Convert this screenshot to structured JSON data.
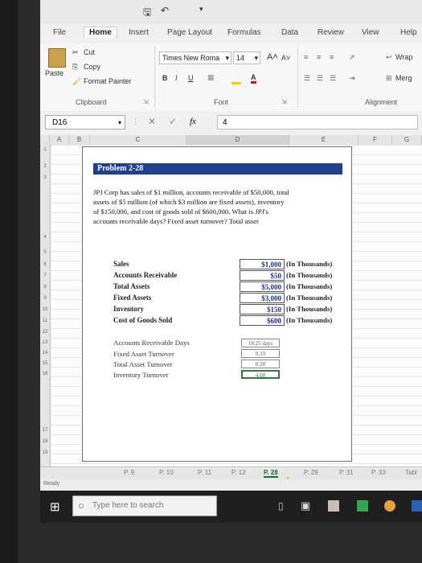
{
  "titlebar": {
    "save_icon": "save-icon",
    "undo_icon": "undo-icon"
  },
  "tabs": [
    "File",
    "Home",
    "Insert",
    "Page Layout",
    "Formulas",
    "Data",
    "Review",
    "View",
    "Help"
  ],
  "ribbon": {
    "cut": "Cut",
    "copy": "Copy",
    "paste": "Paste",
    "format_painter": "Format Painter",
    "clipboard_label": "Clipboard",
    "font_name": "Times New Roma",
    "font_size": "14",
    "bold": "B",
    "italic": "I",
    "underline": "U",
    "font_label": "Font",
    "wrap_text": "Wrap",
    "merge": "Merg",
    "alignment_label": "Alignment"
  },
  "formula_bar": {
    "name_box": "D16",
    "fx": "fx",
    "value": "4"
  },
  "columns": [
    "A",
    "B",
    "C",
    "D",
    "E",
    "F",
    "G"
  ],
  "rows": [
    "1",
    "2",
    "3",
    "4",
    "5",
    "6",
    "7",
    "8",
    "9",
    "10",
    "11",
    "12",
    "13",
    "14",
    "15",
    "16",
    "17",
    "18",
    "19"
  ],
  "problem": {
    "title": "Problem 2-28",
    "text": "JPJ Corp has sales of $1 million, accounts receivable of $50,000, total assets of $5 million (of which $3 million are fixed assets), inventory of $150,000, and cost of goods sold of $600,000. What is JPJ's accounts receivable days? Fixed asset turnover? Total asset",
    "inputs": [
      {
        "label": "Sales",
        "value": "$1,000",
        "unit": "(In Thousands)"
      },
      {
        "label": "Accounts Receivable",
        "value": "$50",
        "unit": "(In Thousands)"
      },
      {
        "label": "Total Assets",
        "value": "$5,000",
        "unit": "(In Thousands)"
      },
      {
        "label": "Fixed Assets",
        "value": "$3,000",
        "unit": "(In Thousands)"
      },
      {
        "label": "Inventory",
        "value": "$150",
        "unit": "(In Thousands)"
      },
      {
        "label": "Cost of Goods Sold",
        "value": "$600",
        "unit": "(In Thousands)"
      }
    ],
    "results": [
      {
        "label": "Accounts Receivable Days",
        "value": "18.25 days"
      },
      {
        "label": "Fixed Asset Turnover",
        "value": "0.33"
      },
      {
        "label": "Total Asset Turnover",
        "value": "0.20"
      },
      {
        "label": "Inventory Turnover",
        "value": "4.00"
      }
    ]
  },
  "sheet_tabs": [
    "P. 9",
    "P. 10",
    "P. 11",
    "P. 12",
    "P. 28",
    "P. 29",
    "P. 31",
    "P. 33",
    "Tabl"
  ],
  "status": {
    "ready": "Ready"
  },
  "taskbar": {
    "search_placeholder": "Type here to search"
  }
}
